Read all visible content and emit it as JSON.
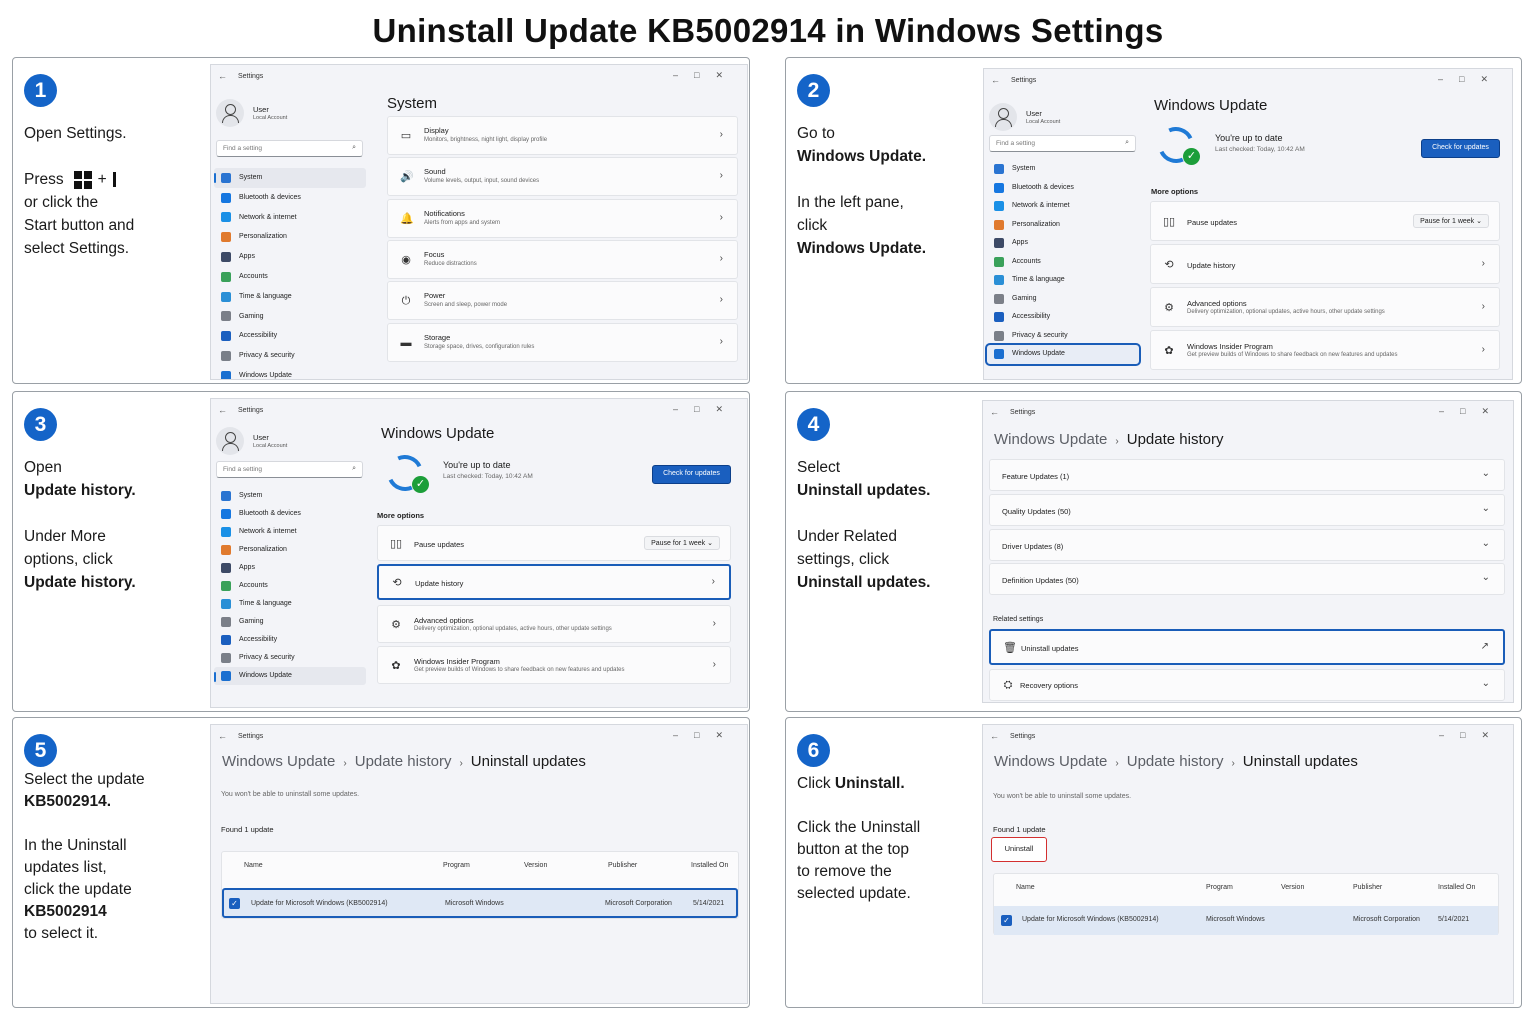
{
  "title": "Uninstall Update KB5002914 in Windows Settings",
  "common": {
    "window_title": "Settings",
    "user_name": "User",
    "user_sub": "Local Account",
    "search_placeholder": "Find a setting",
    "nav": [
      "System",
      "Bluetooth & devices",
      "Network & internet",
      "Personalization",
      "Apps",
      "Accounts",
      "Time & language",
      "Gaming",
      "Accessibility",
      "Privacy & security",
      "Windows Update"
    ],
    "nav_icons": [
      "monitor-icon",
      "bluetooth-icon",
      "wifi-icon",
      "brush-icon",
      "apps-icon",
      "person-icon",
      "globe-clock-icon",
      "gamepad-icon",
      "accessibility-icon",
      "shield-icon",
      "update-icon"
    ],
    "nav_colors": [
      "#2a74d1",
      "#1677e0",
      "#1a90e6",
      "#e07a2e",
      "#3d4a66",
      "#3aa15a",
      "#2a8fd6",
      "#7b7f88",
      "#1b5fbf",
      "#7a7f88",
      "#1a6fd0"
    ],
    "wu_title": "Windows Update",
    "up_to_date": "You're up to date",
    "last_checked": "Last checked: Today, 10:42 AM",
    "check_btn": "Check for updates",
    "more_options": "More options",
    "pause_label": "Pause updates",
    "pause_value": "Pause for 1 week",
    "update_history": "Update history",
    "advanced_title": "Advanced options",
    "advanced_sub": "Delivery optimization, optional updates, active hours, other update settings",
    "insider_title": "Windows Insider Program",
    "insider_sub": "Get preview builds of Windows to share feedback on new features and updates",
    "uninstall_updates": "Uninstall updates",
    "cannot_uninstall": "You won't be able to uninstall some updates.",
    "found": "Found 1 update",
    "table_headers": [
      "Name",
      "Program",
      "Version",
      "Publisher",
      "Installed On"
    ],
    "table_row": [
      "Update for Microsoft Windows (KB5002914)",
      "Microsoft Windows",
      "",
      "Microsoft Corporation",
      "5/14/2021"
    ],
    "uninstall_btn": "Uninstall"
  },
  "steps": [
    {
      "num": "1",
      "text_a": "Open Settings.",
      "text_b": "Press",
      "text_c": "+",
      "text_d": "or click the",
      "text_e": "Start button and",
      "text_f": "select Settings."
    },
    {
      "num": "2",
      "l1": "Go to",
      "l2": "Windows Update.",
      "l3": "In the left pane,",
      "l4": "click",
      "l5": "Windows Update."
    },
    {
      "num": "3",
      "l1": "Open",
      "l2": "Update history.",
      "l3": "Under More",
      "l4": "options, click",
      "l5": "Update history."
    },
    {
      "num": "4",
      "l1": "Select",
      "l2": "Uninstall updates.",
      "l3": "Under Related",
      "l4": "settings, click",
      "l5": "Uninstall updates."
    },
    {
      "num": "5",
      "l1": "Select the update",
      "l2": "KB5002914.",
      "l3": "In the Uninstall",
      "l4": "updates list,",
      "l5": "click the update",
      "l6": "KB5002914",
      "l7": "to select it."
    },
    {
      "num": "6",
      "l1_a": "Click ",
      "l1_b": "Uninstall.",
      "l3": "Click the Uninstall",
      "l4": "button at the top",
      "l5": "to remove the",
      "l6": "selected update."
    }
  ],
  "system_page": {
    "title": "System",
    "items": [
      {
        "title": "Display",
        "sub": "Monitors, brightness, night light, display profile",
        "icon": "display-icon"
      },
      {
        "title": "Sound",
        "sub": "Volume levels, output, input, sound devices",
        "icon": "speaker-icon"
      },
      {
        "title": "Notifications",
        "sub": "Alerts from apps and system",
        "icon": "bell-icon"
      },
      {
        "title": "Focus",
        "sub": "Reduce distractions",
        "icon": "focus-icon"
      },
      {
        "title": "Power",
        "sub": "Screen and sleep, power mode",
        "icon": "power-icon"
      },
      {
        "title": "Storage",
        "sub": "Storage space, drives, configuration rules",
        "icon": "storage-icon"
      }
    ]
  },
  "history_page": {
    "sections": [
      "Feature Updates (1)",
      "Quality Updates (50)",
      "Driver Updates (8)",
      "Definition Updates (50)"
    ],
    "related": "Related settings",
    "recovery": "Recovery options"
  },
  "colors": {
    "accent": "#1a5fbf",
    "step_badge": "#1464c8",
    "highlight": "#1a5db8",
    "uninstall_highlight": "#d32f2f",
    "success": "#1c9e3a"
  }
}
